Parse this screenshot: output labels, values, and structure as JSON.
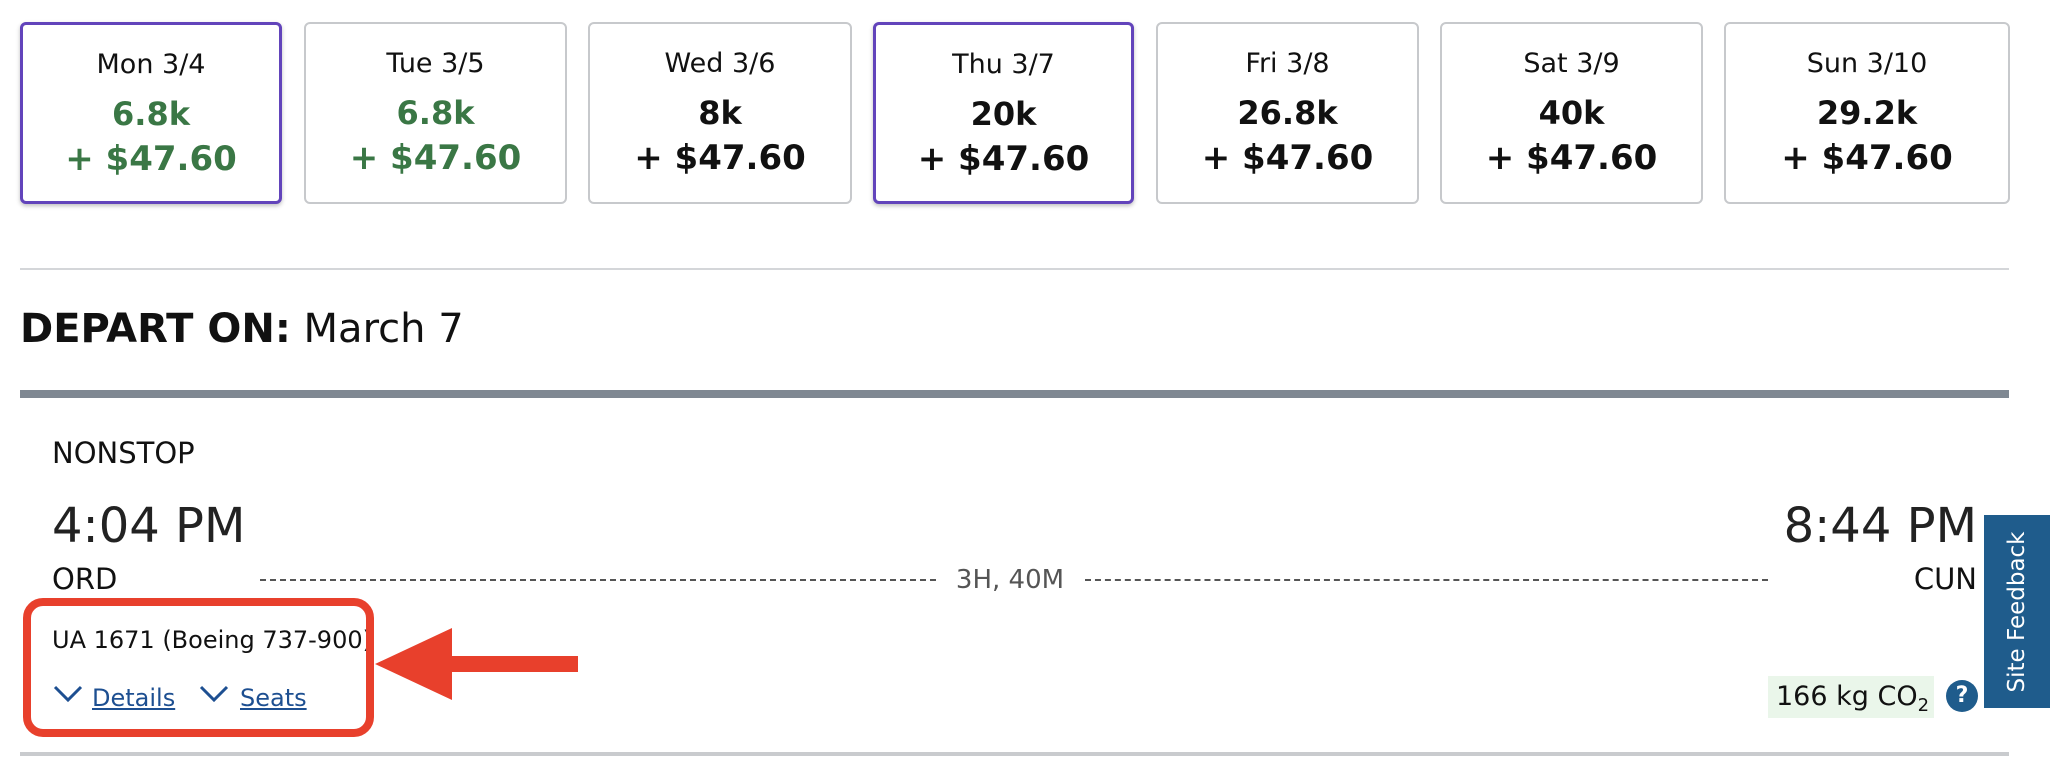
{
  "days": [
    {
      "label": "Mon 3/4",
      "miles": "6.8k",
      "fee": "+ $47.60",
      "lowest": true,
      "selected": true
    },
    {
      "label": "Tue 3/5",
      "miles": "6.8k",
      "fee": "+ $47.60",
      "lowest": true,
      "selected": false
    },
    {
      "label": "Wed 3/6",
      "miles": "8k",
      "fee": "+ $47.60",
      "lowest": false,
      "selected": false
    },
    {
      "label": "Thu 3/7",
      "miles": "20k",
      "fee": "+ $47.60",
      "lowest": false,
      "selected": true
    },
    {
      "label": "Fri 3/8",
      "miles": "26.8k",
      "fee": "+ $47.60",
      "lowest": false,
      "selected": false
    },
    {
      "label": "Sat 3/9",
      "miles": "40k",
      "fee": "+ $47.60",
      "lowest": false,
      "selected": false
    },
    {
      "label": "Sun 3/10",
      "miles": "29.2k",
      "fee": "+ $47.60",
      "lowest": false,
      "selected": false
    }
  ],
  "depart": {
    "label": "DEPART ON:",
    "date": "March 7"
  },
  "flight": {
    "stops": "NONSTOP",
    "depart_time": "4:04 PM",
    "arrive_time": "8:44 PM",
    "origin": "ORD",
    "destination": "CUN",
    "duration": "3H, 40M",
    "number": "UA 1671 (Boeing 737-900)",
    "details_label": "Details",
    "seats_label": "Seats",
    "co2_value": "166 kg CO",
    "co2_sub": "2",
    "help_label": "?"
  },
  "feedback_label": "Site Feedback",
  "colors": {
    "accent_purple": "#6244bb",
    "low_green": "#3a7745",
    "annotation_red": "#e8402c",
    "feedback_blue": "#1f5c8c"
  }
}
